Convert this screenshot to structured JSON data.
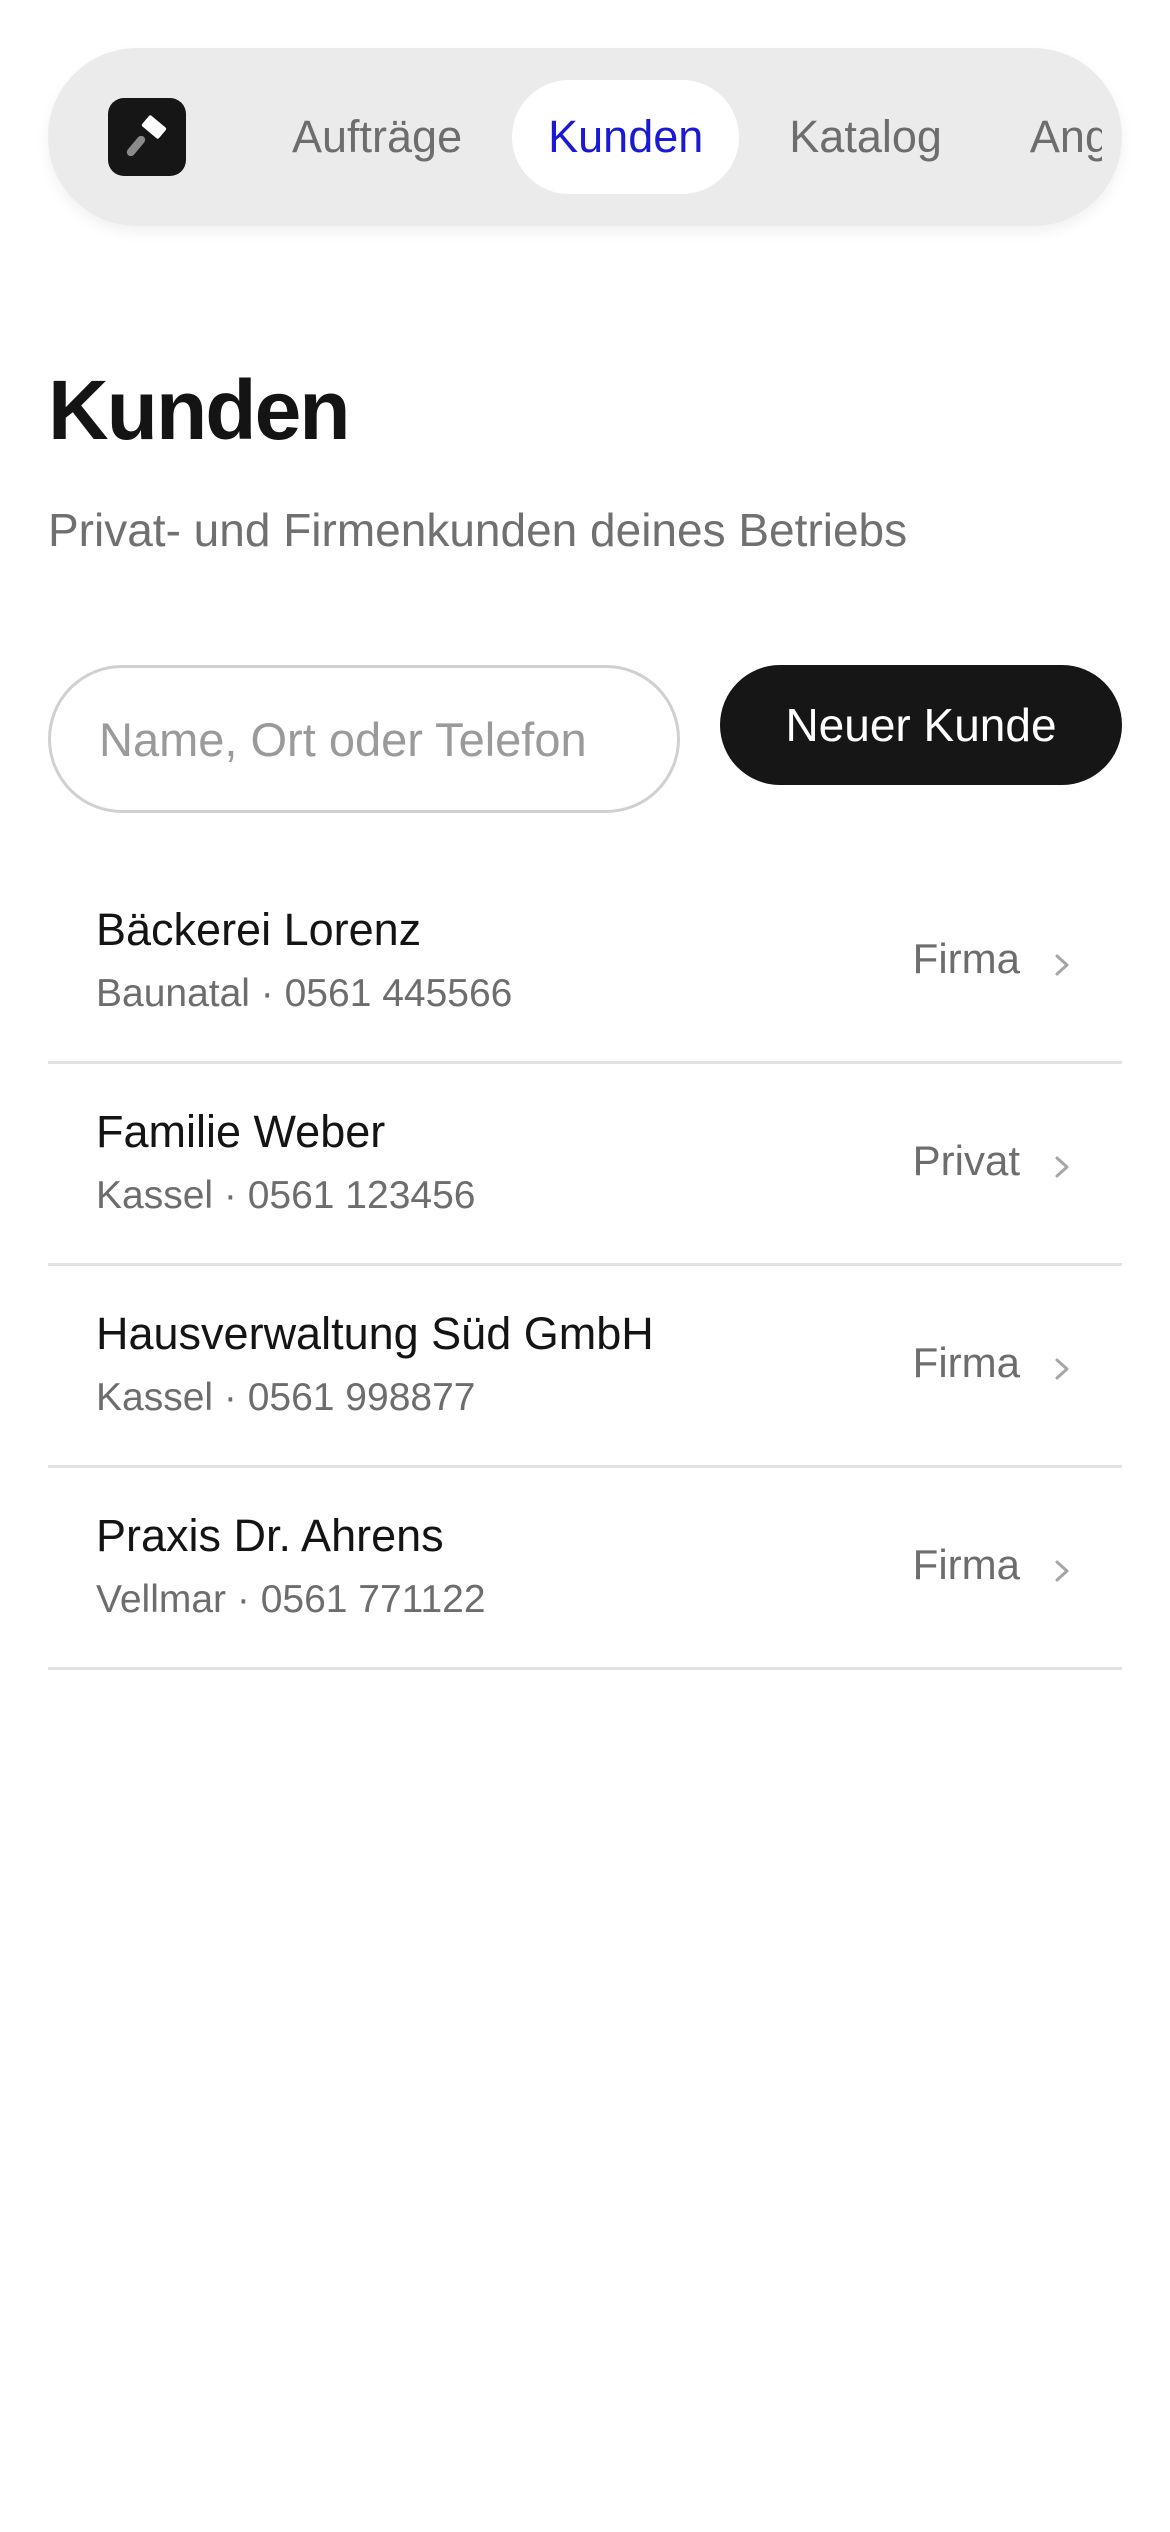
{
  "nav": {
    "logo_icon": "hammer-icon",
    "tabs": [
      {
        "label": "Aufträge",
        "active": false
      },
      {
        "label": "Kunden",
        "active": true
      },
      {
        "label": "Katalog",
        "active": false
      },
      {
        "label": "Angebote",
        "active": false
      }
    ],
    "active_color": "#1a1ad6"
  },
  "page": {
    "title": "Kunden",
    "subtitle": "Privat- und Firmenkunden deines Betriebs"
  },
  "search": {
    "placeholder": "Name, Ort oder Telefon",
    "value": ""
  },
  "actions": {
    "new_customer_label": "Neuer Kunde"
  },
  "customers": [
    {
      "name": "Bäckerei Lorenz",
      "meta": "Baunatal · 0561 445566",
      "type": "Firma"
    },
    {
      "name": "Familie Weber",
      "meta": "Kassel · 0561 123456",
      "type": "Privat"
    },
    {
      "name": "Hausverwaltung Süd GmbH",
      "meta": "Kassel · 0561 998877",
      "type": "Firma"
    },
    {
      "name": "Praxis Dr. Ahrens",
      "meta": "Vellmar · 0561 771122",
      "type": "Firma"
    }
  ]
}
